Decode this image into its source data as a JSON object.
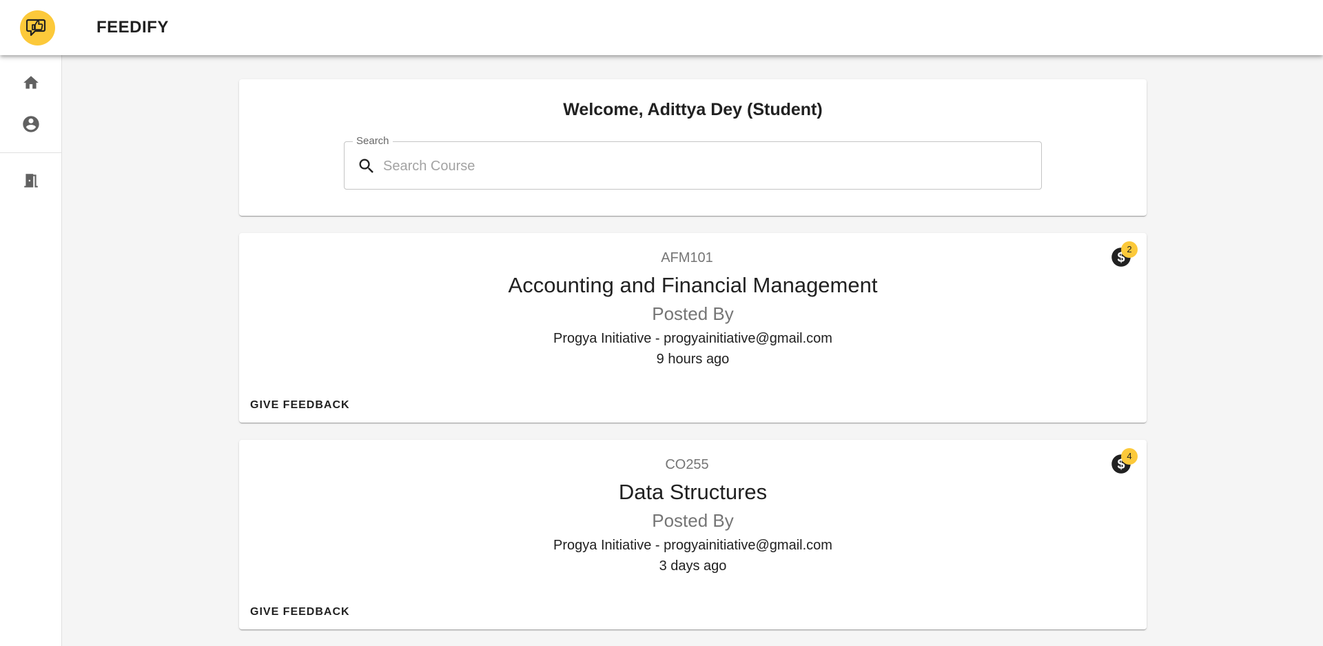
{
  "app": {
    "brand": "FEEDIFY",
    "accent_color": "#fcc93a"
  },
  "nav": {
    "items": [
      {
        "icon": "home-icon",
        "label": ""
      },
      {
        "icon": "account-circle-icon",
        "label": ""
      },
      {
        "icon": "logout-door-icon",
        "label": ""
      }
    ]
  },
  "welcome": {
    "title": "Welcome, Adittya Dey (Student)"
  },
  "search": {
    "legend": "Search",
    "placeholder": "Search Course",
    "value": ""
  },
  "courses": [
    {
      "code": "AFM101",
      "title": "Accounting and Financial Management",
      "posted_by_label": "Posted By",
      "author": "Progya Initiative - progyainitiative@gmail.com",
      "time": "9 hours ago",
      "badge_count": "2",
      "action_label": "GIVE FEEDBACK"
    },
    {
      "code": "CO255",
      "title": "Data Structures",
      "posted_by_label": "Posted By",
      "author": "Progya Initiative - progyainitiative@gmail.com",
      "time": "3 days ago",
      "badge_count": "4",
      "action_label": "GIVE FEEDBACK"
    }
  ]
}
